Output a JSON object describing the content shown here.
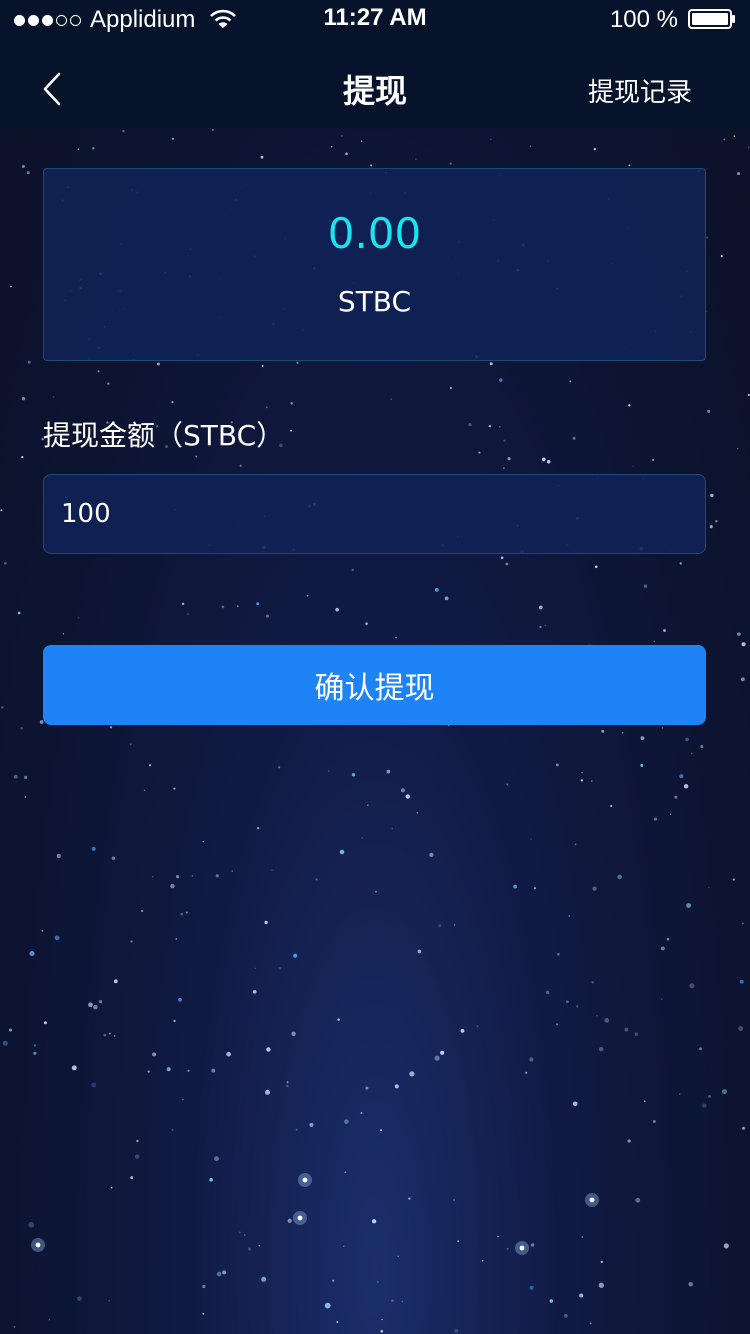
{
  "status_bar": {
    "carrier": "Applidium",
    "time": "11:27 AM",
    "battery": "100 %"
  },
  "nav": {
    "title": "提现",
    "right_link": "提现记录",
    "back_icon": "chevron-left-icon"
  },
  "balance": {
    "amount": "0.00",
    "unit": "STBC",
    "amount_color": "#19e5f0"
  },
  "form": {
    "amount_label": "提现金额（STBC）",
    "amount_value": "100"
  },
  "actions": {
    "confirm_label": "确认提现",
    "confirm_color": "#1f83f8"
  }
}
